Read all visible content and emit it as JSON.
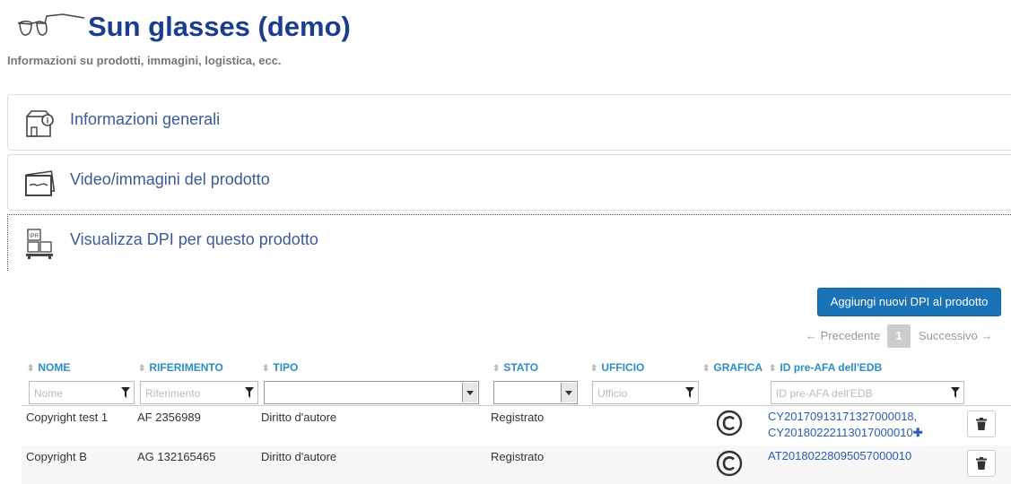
{
  "header": {
    "title": "Sun glasses (demo)",
    "subtitle": "Informazioni su prodotti, immagini, logistica, ecc.",
    "logo_icon": "glasses-icon"
  },
  "panels": [
    {
      "label": "Informazioni generali",
      "icon": "box-info-icon"
    },
    {
      "label": "Video/immagini del prodotto",
      "icon": "photos-icon"
    },
    {
      "label": "Visualizza DPI per questo prodotto",
      "icon": "ipr-boxes-icon"
    }
  ],
  "actions": {
    "add_label": "Aggiungi nuovi DPI al prodotto"
  },
  "pager": {
    "prev": "← Precedente",
    "page": "1",
    "next": "Successivo →"
  },
  "table": {
    "columns": [
      "NOME",
      "RIFERIMENTO",
      "TIPO",
      "STATO",
      "UFFICIO",
      "GRAFICA",
      "ID pre-AFA dell'EDB"
    ],
    "filters": {
      "nome": "Nome",
      "riferimento": "Riferimento",
      "ufficio": "Ufficio",
      "id": "ID pre-AFA dell'EDB"
    },
    "rows": [
      {
        "nome": "Copyright test 1",
        "riferimento": "AF 2356989",
        "tipo": "Diritto d'autore",
        "stato": "Registrato",
        "ufficio": "",
        "id": "CY20170913171327000018, CY20180222113017000010",
        "more": "✚"
      },
      {
        "nome": "Copyright B",
        "riferimento": "AG 132165465",
        "tipo": "Diritto d'autore",
        "stato": "Registrato",
        "ufficio": "",
        "id": "AT20180228095057000010",
        "more": ""
      }
    ]
  },
  "colors": {
    "title": "#1a3d8f",
    "accent": "#1a73b7",
    "link": "#2a5db0",
    "header_link": "#2a8ec8"
  }
}
